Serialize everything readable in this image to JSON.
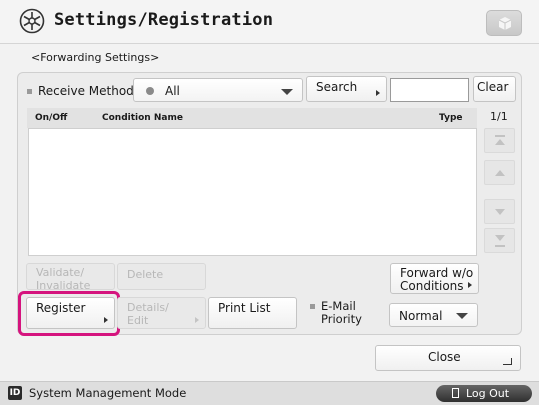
{
  "header": {
    "title": "Settings/Registration",
    "logo_icon": "settings-registration-icon",
    "right_icon": "cube-icon"
  },
  "subtitle": "<Forwarding Settings>",
  "receive_method": {
    "label": "Receive Method:",
    "value": "All"
  },
  "search": {
    "button_label": "Search",
    "input_value": ""
  },
  "clear_label": "Clear",
  "list": {
    "columns": {
      "onoff": "On/Off",
      "name": "Condition Name",
      "type": "Type"
    },
    "rows": [],
    "page": "1/1"
  },
  "buttons": {
    "validate": "Validate/\nInvalidate",
    "delete": "Delete",
    "forward": "Forward w/o\nConditions",
    "register": "Register",
    "details": "Details/\nEdit",
    "print_list": "Print List",
    "close": "Close"
  },
  "email_priority": {
    "label": "E-Mail\nPriority",
    "value": "Normal"
  },
  "status_bar": {
    "badge": "ID",
    "mode": "System Management Mode",
    "logout": "Log Out"
  },
  "colors": {
    "highlight": "#d5147e"
  }
}
